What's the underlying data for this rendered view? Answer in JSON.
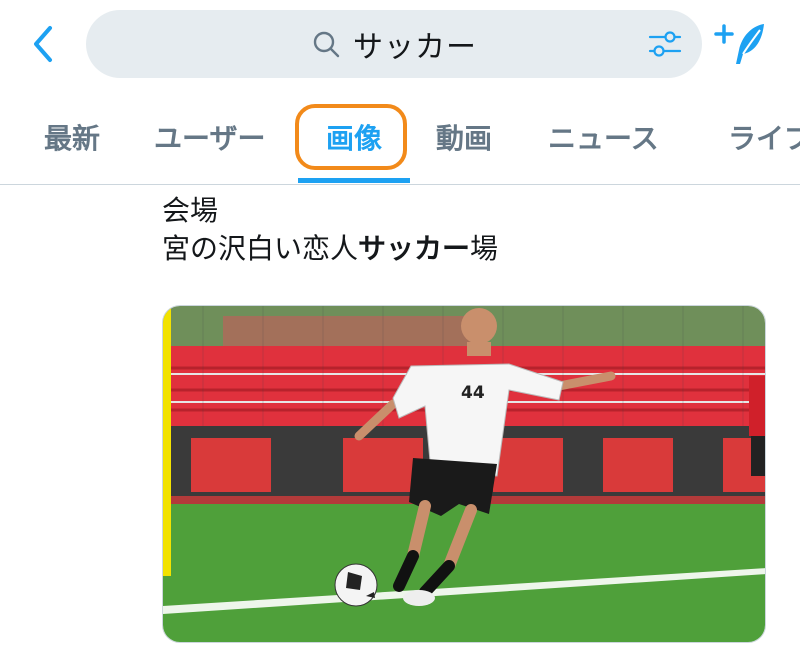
{
  "header": {
    "search_query": "サッカー"
  },
  "tabs": [
    {
      "label": "最新"
    },
    {
      "label": "ユーザー"
    },
    {
      "label": "画像"
    },
    {
      "label": "動画"
    },
    {
      "label": "ニュース"
    },
    {
      "label": "ライブ"
    }
  ],
  "tweet": {
    "line1": "会場",
    "line2_prefix": "宮の沢白い恋人",
    "line2_bold": "サッカー",
    "line2_suffix": "場"
  },
  "media": {
    "jersey_number": "44",
    "colors": {
      "stands_red": "#e0313d",
      "pitch_green": "#4fa03a",
      "highlight_orange": "#f28a1a",
      "accent_blue": "#1da1f2"
    }
  }
}
